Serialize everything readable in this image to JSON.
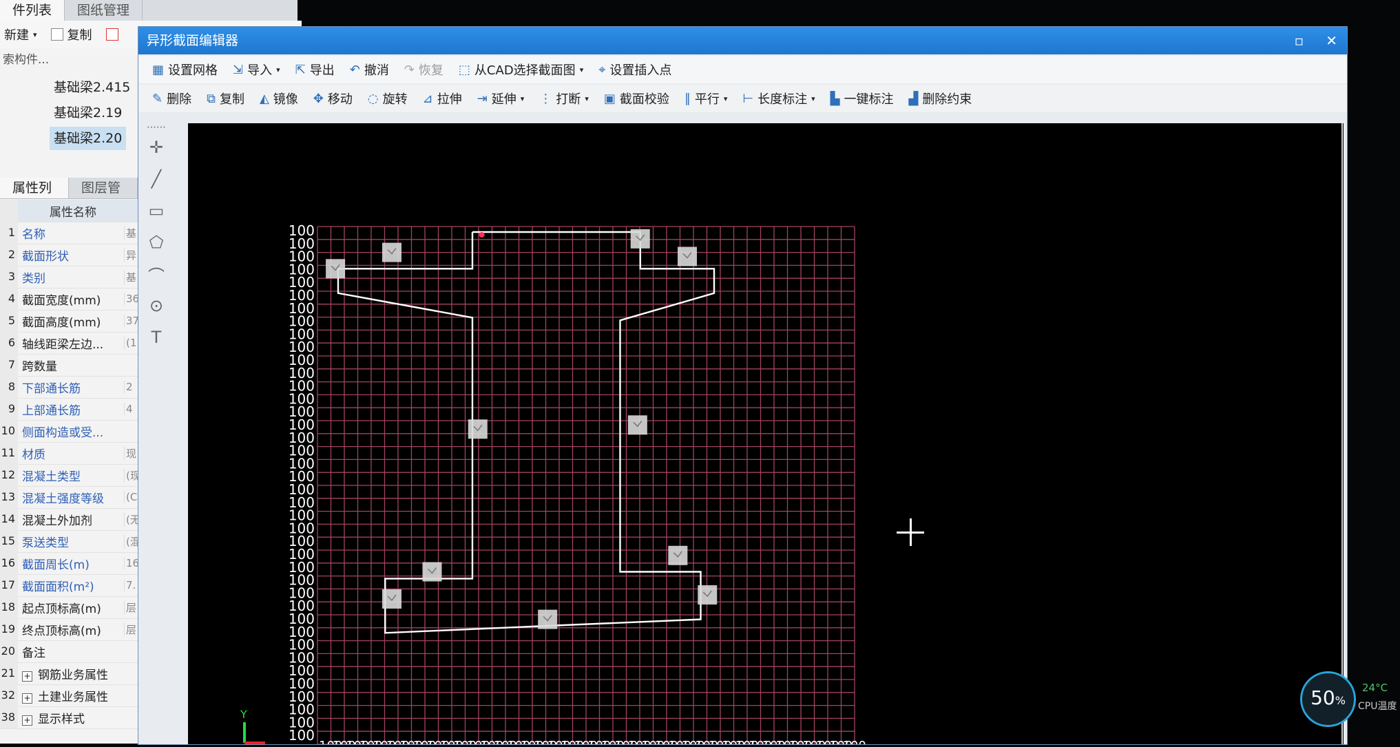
{
  "left_panel": {
    "top_tabs": [
      "件列表",
      "图纸管理"
    ],
    "toolbar": {
      "new_label": "新建",
      "copy_label": "复制"
    },
    "search_text": "索构件...",
    "beams": [
      "基础梁2.415",
      "基础梁2.19",
      "基础梁2.20"
    ],
    "selected_beam_index": 2,
    "attr_tabs": [
      "属性列表",
      "图层管理"
    ],
    "attr_header": "属性名称",
    "attr_rows": [
      {
        "n": "1",
        "k": "名称",
        "v": "基",
        "color": "blue"
      },
      {
        "n": "2",
        "k": "截面形状",
        "v": "异",
        "color": "blue"
      },
      {
        "n": "3",
        "k": "类别",
        "v": "基",
        "color": "blue"
      },
      {
        "n": "4",
        "k": "截面宽度(mm)",
        "v": "36",
        "color": "dark"
      },
      {
        "n": "5",
        "k": "截面高度(mm)",
        "v": "37",
        "color": "dark"
      },
      {
        "n": "6",
        "k": "轴线距梁左边...",
        "v": "(1",
        "color": "dark"
      },
      {
        "n": "7",
        "k": "跨数量",
        "v": "",
        "color": "dark"
      },
      {
        "n": "8",
        "k": "下部通长筋",
        "v": "2",
        "color": "blue"
      },
      {
        "n": "9",
        "k": "上部通长筋",
        "v": "4",
        "color": "blue"
      },
      {
        "n": "10",
        "k": "侧面构造或受...",
        "v": "",
        "color": "blue"
      },
      {
        "n": "11",
        "k": "材质",
        "v": "现",
        "color": "blue"
      },
      {
        "n": "12",
        "k": "混凝土类型",
        "v": "(现",
        "color": "blue"
      },
      {
        "n": "13",
        "k": "混凝土强度等级",
        "v": "(C",
        "color": "blue"
      },
      {
        "n": "14",
        "k": "混凝土外加剂",
        "v": "(无",
        "color": "dark"
      },
      {
        "n": "15",
        "k": "泵送类型",
        "v": "(混",
        "color": "blue"
      },
      {
        "n": "16",
        "k": "截面周长(m)",
        "v": "16",
        "color": "blue"
      },
      {
        "n": "17",
        "k": "截面面积(m²)",
        "v": "7.",
        "color": "blue"
      },
      {
        "n": "18",
        "k": "起点顶标高(m)",
        "v": "层",
        "color": "dark"
      },
      {
        "n": "19",
        "k": "终点顶标高(m)",
        "v": "层",
        "color": "dark"
      },
      {
        "n": "20",
        "k": "备注",
        "v": "",
        "color": "dark"
      },
      {
        "n": "21",
        "k": "钢筋业务属性",
        "v": "",
        "color": "dark",
        "plus": true
      },
      {
        "n": "32",
        "k": "土建业务属性",
        "v": "",
        "color": "dark",
        "plus": true
      },
      {
        "n": "38",
        "k": "显示样式",
        "v": "",
        "color": "dark",
        "plus": true
      }
    ]
  },
  "dialog": {
    "title": "异形截面编辑器",
    "toolbar1": [
      {
        "label": "设置网格",
        "icon": "grid-icon"
      },
      {
        "label": "导入",
        "icon": "import-icon",
        "dropdown": true
      },
      {
        "label": "导出",
        "icon": "export-icon"
      },
      {
        "label": "撤消",
        "icon": "undo-icon"
      },
      {
        "label": "恢复",
        "icon": "redo-icon",
        "disabled": true
      },
      {
        "label": "从CAD选择截面图",
        "icon": "cad-select-icon",
        "dropdown": true
      },
      {
        "label": "设置插入点",
        "icon": "insert-point-icon"
      }
    ],
    "toolbar2": [
      {
        "label": "删除",
        "icon": "delete-icon"
      },
      {
        "label": "复制",
        "icon": "copy-icon"
      },
      {
        "label": "镜像",
        "icon": "mirror-icon"
      },
      {
        "label": "移动",
        "icon": "move-icon"
      },
      {
        "label": "旋转",
        "icon": "rotate-icon"
      },
      {
        "label": "拉伸",
        "icon": "stretch-icon"
      },
      {
        "label": "延伸",
        "icon": "extend-icon",
        "dropdown": true
      },
      {
        "label": "打断",
        "icon": "break-icon",
        "dropdown": true
      },
      {
        "label": "截面校验",
        "icon": "check-icon"
      },
      {
        "label": "平行",
        "icon": "parallel-icon",
        "dropdown": true
      },
      {
        "label": "长度标注",
        "icon": "dimension-icon",
        "dropdown": true
      },
      {
        "label": "一键标注",
        "icon": "auto-dimension-icon"
      },
      {
        "label": "删除约束",
        "icon": "delete-constraint-icon"
      }
    ],
    "side_tools": [
      "point-icon",
      "line-icon",
      "rectangle-icon",
      "polygon-icon",
      "arc-icon",
      "circle-icon",
      "text-icon"
    ],
    "grid": {
      "label": "100",
      "rows": 40,
      "cols": 40,
      "line_color": "#a2455e",
      "label_color": "#ffffff"
    }
  },
  "cpu": {
    "usage": "50",
    "unit": "%",
    "temp": "24°C",
    "label": "CPU温度"
  }
}
